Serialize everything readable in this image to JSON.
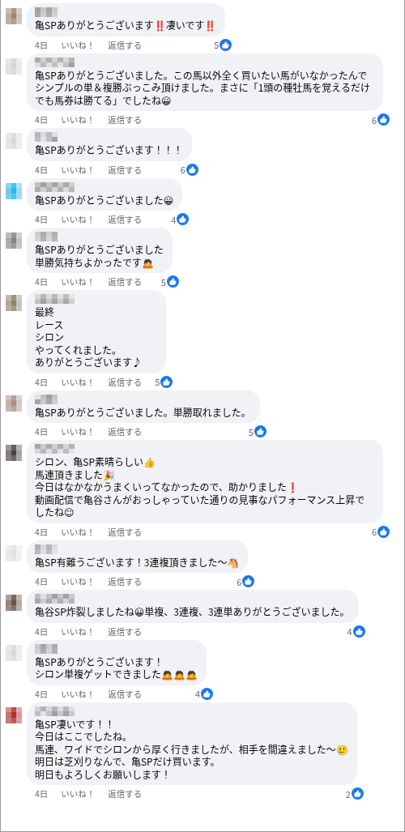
{
  "comments": [
    {
      "color": "#a08470",
      "lines": [
        "亀SPありがとうございます‼️凄いです‼️"
      ],
      "time": "4日",
      "like": "いいね！",
      "reply": "返信する",
      "reactions": "5"
    },
    {
      "color": "#d4d4d8",
      "lines": [
        "亀SPありがとうございました。この馬以外全く買いたい馬がいなかったんでシンプルの単＆複勝ぶっこみ頂けました。まさに「1頭の種牡馬を覚えるだけでも馬券は勝てる」でしたね😀"
      ],
      "time": "4日",
      "like": "いいね！",
      "reply": "返信する",
      "reactions": "6"
    },
    {
      "color": "#d8d8dc",
      "lines": [
        "亀SPありがとうございます！！！"
      ],
      "time": "4日",
      "like": "いいね！",
      "reply": "返信する",
      "reactions": "6"
    },
    {
      "color": "#2bb8e8",
      "lines": [
        "亀SPありがとうございました😀"
      ],
      "time": "4日",
      "like": "いいね！",
      "reply": "返信する",
      "reactions": "4"
    },
    {
      "color": "#8a8088",
      "lines": [
        "亀SPありがとうございました",
        "単勝気持ちよかったです🙇"
      ],
      "time": "4日",
      "like": "いいね！",
      "reply": "返信する",
      "reactions": "5"
    },
    {
      "color": "#8c8070",
      "lines": [
        "最終",
        "レース",
        "シロン",
        "やってくれました。",
        "ありがとうございます♪"
      ],
      "time": "4日",
      "like": "いいね！",
      "reply": "返信する",
      "reactions": "5"
    },
    {
      "color": "#a89088",
      "lines": [
        "亀SPありがとうございました。単勝取れました。"
      ],
      "time": "4日",
      "like": "いいね！",
      "reply": "返信する",
      "reactions": "5"
    },
    {
      "color": "#4a4240",
      "lines": [
        "シロン、亀SP素晴らしい👍",
        "馬連頂きました🎉",
        "今日はなかなかうまくいってなかったので、助かりました❗",
        "動画配信で亀谷さんがおっしゃっていた通りの見事なパフォーマンス上昇でしたね😊"
      ],
      "time": "4日",
      "like": "いいね！",
      "reply": "返信する",
      "reactions": "6"
    },
    {
      "color": "#e0e0e6",
      "lines": [
        "亀SP有難うございます！3連複頂きました〜🐴"
      ],
      "time": "4日",
      "like": "いいね！",
      "reply": "返信する",
      "reactions": "6"
    },
    {
      "color": "#6a5040",
      "lines": [
        "亀谷SP炸裂しましたね😀単複、3連複、3連単ありがとうございました。"
      ],
      "time": "4日",
      "like": "いいね！",
      "reply": "返信する",
      "reactions": "4"
    },
    {
      "color": "#d8d8dc",
      "lines": [
        "亀SPありがとうございます！",
        "シロン単複ゲットできました🙇🙇🙇"
      ],
      "time": "4日",
      "like": "いいね！",
      "reply": "返信する",
      "reactions": "4"
    },
    {
      "color": "#b03030",
      "lines": [
        "亀SP凄いです！！",
        "今日はここでしたね。",
        "馬連、ワイドでシロンから厚く行きましたが、相手を間違えました〜🥲",
        "明日は芝刈りなんで、亀SPだけ買います。",
        "明日もよろしくお願いします！"
      ],
      "time": "4日",
      "like": "いいね！",
      "reply": "返信する",
      "reactions": "2"
    }
  ]
}
